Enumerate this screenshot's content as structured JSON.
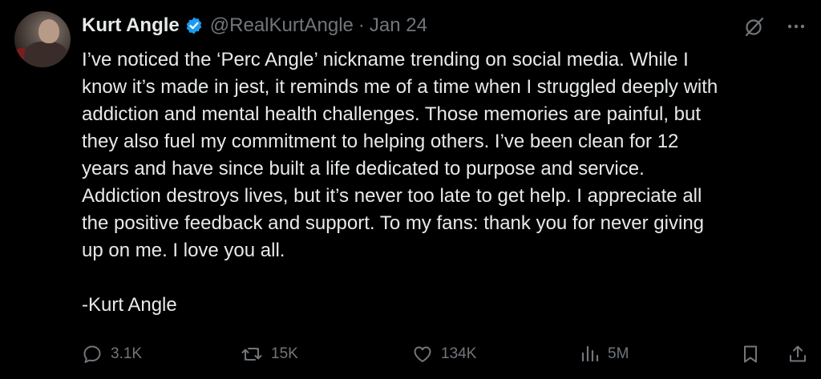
{
  "colors": {
    "background": "#000000",
    "text": "#e7e9ea",
    "muted": "#71767b",
    "verified_badge": "#1d9bf0"
  },
  "author": {
    "display_name": "Kurt Angle",
    "handle": "@RealKurtAngle",
    "separator": "·",
    "date": "Jan 24",
    "verified_icon": "verified-badge-icon"
  },
  "tweet": {
    "text": "I’ve noticed the ‘Perc Angle’ nickname trending on social media. While I\nknow it’s made in jest, it reminds me of a time when I struggled deeply with\naddiction and mental health challenges. Those memories are painful, but\nthey also fuel my commitment to helping others. I’ve been clean for 12\nyears and have since built a life dedicated to purpose and service.\nAddiction destroys lives, but it’s never too late to get help. I appreciate all\nthe positive feedback and support. To my fans: thank you for never giving\nup on me. I love you all.\n\n-Kurt Angle"
  },
  "top_actions": {
    "grok_icon": "grok-icon",
    "more_icon": "more-icon"
  },
  "metrics": {
    "replies": "3.1K",
    "retweets": "15K",
    "likes": "134K",
    "views": "5M"
  }
}
